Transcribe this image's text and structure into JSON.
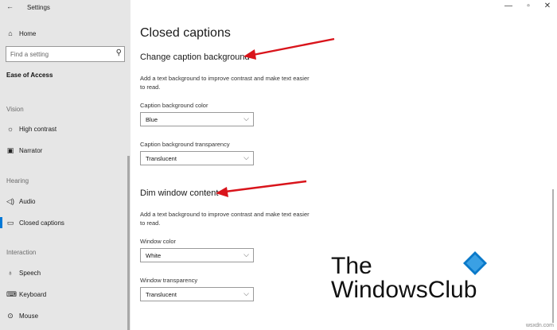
{
  "window": {
    "title": "Settings",
    "controls": {
      "minimize": "—",
      "maximize": "▫",
      "close": "✕"
    }
  },
  "sidebar": {
    "home": "Home",
    "search_placeholder": "Find a setting",
    "section": "Ease of Access",
    "groups": [
      {
        "label": "Vision",
        "items": [
          {
            "label": "High contrast",
            "icon": "sun-icon"
          },
          {
            "label": "Narrator",
            "icon": "narrator-icon"
          }
        ]
      },
      {
        "label": "Hearing",
        "items": [
          {
            "label": "Audio",
            "icon": "speaker-icon"
          },
          {
            "label": "Closed captions",
            "icon": "cc-icon"
          }
        ]
      },
      {
        "label": "Interaction",
        "items": [
          {
            "label": "Speech",
            "icon": "mic-icon"
          },
          {
            "label": "Keyboard",
            "icon": "keyboard-icon"
          },
          {
            "label": "Mouse",
            "icon": "mouse-icon"
          }
        ]
      }
    ],
    "selected": "Closed captions"
  },
  "main": {
    "title": "Closed captions",
    "sections": [
      {
        "heading": "Change caption background",
        "description": "Add a text background to improve contrast and make text easier to read.",
        "fields": [
          {
            "label": "Caption background color",
            "value": "Blue"
          },
          {
            "label": "Caption background transparency",
            "value": "Translucent"
          }
        ]
      },
      {
        "heading": "Dim window content",
        "description": "Add a text background to improve contrast and make text easier to read.",
        "fields": [
          {
            "label": "Window color",
            "value": "White"
          },
          {
            "label": "Window transparency",
            "value": "Translucent"
          }
        ]
      }
    ]
  },
  "watermark": {
    "line1": "The",
    "line2": "WindowsClub",
    "site": "wsxdn.com"
  },
  "colors": {
    "accent": "#0078d7",
    "arrow": "#d9141b",
    "logo_blue": "#0a79c9"
  }
}
